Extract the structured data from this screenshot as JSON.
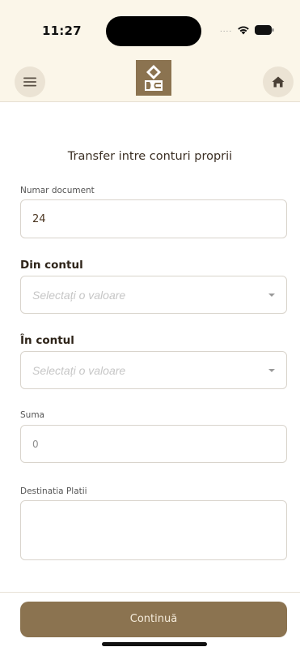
{
  "status_bar": {
    "time": "11:27",
    "icons": [
      "signal-dots-icon",
      "wifi-icon",
      "battery-icon"
    ]
  },
  "header": {
    "icons": [
      "menu-icon",
      "bank-logo",
      "home-icon"
    ]
  },
  "form": {
    "title": "Transfer intre conturi proprii",
    "numar_document": {
      "label": "Numar document",
      "value": "24"
    },
    "din_contul": {
      "label": "Din contul",
      "placeholder": "Selectați o valoare"
    },
    "in_contul": {
      "label": "În contul",
      "placeholder": "Selectați o valoare"
    },
    "suma": {
      "label": "Suma",
      "value": "0"
    },
    "destinatia": {
      "label": "Destinatia Platii",
      "value": ""
    }
  },
  "footer": {
    "continue_label": "Continuă"
  },
  "colors": {
    "accent": "#8b7350",
    "header_bg": "#fbf6e9",
    "icon_circle": "#ebe3d4"
  }
}
